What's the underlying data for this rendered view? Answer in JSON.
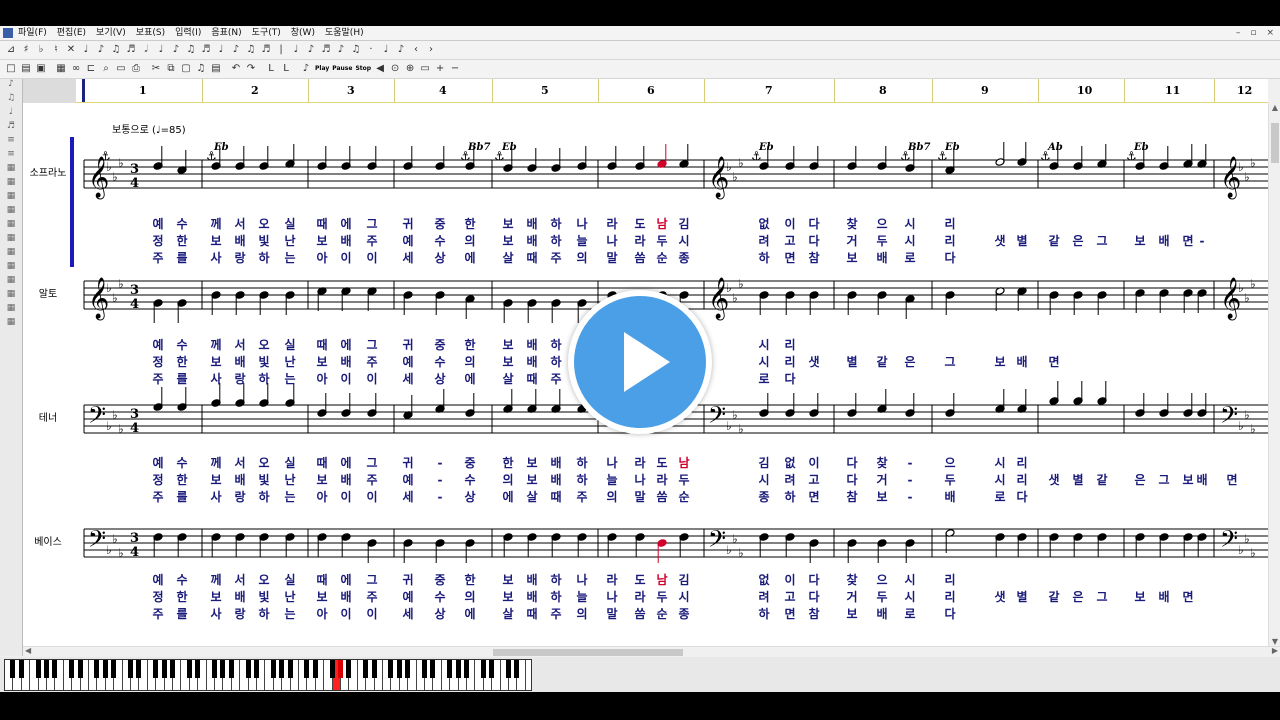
{
  "menu": [
    "파일(F)",
    "편집(E)",
    "보기(V)",
    "보표(S)",
    "입력(I)",
    "음표(N)",
    "도구(T)",
    "창(W)",
    "도움말(H)"
  ],
  "window_controls": [
    "–",
    "▫",
    "×"
  ],
  "toolbar_text_buttons": [
    "Play",
    "Pause",
    "Stop"
  ],
  "measure_numbers": [
    "1",
    "2",
    "3",
    "4",
    "5",
    "6",
    "7",
    "8",
    "9",
    "10",
    "11",
    "12"
  ],
  "tempo": "보통으로 (♩=85)",
  "time_signature": {
    "top": "3",
    "bottom": "4"
  },
  "staves": [
    {
      "name": "소프라노",
      "clef": "treble"
    },
    {
      "name": "알토",
      "clef": "treble"
    },
    {
      "name": "테너",
      "clef": "bass"
    },
    {
      "name": "베이스",
      "clef": "bass"
    }
  ],
  "chords": [
    "Eb",
    "Bb7",
    "Eb",
    "Eb",
    "Bb7",
    "Eb",
    "Ab",
    "Eb"
  ],
  "lyrics": {
    "soprano": [
      [
        "예",
        "수",
        "께",
        "서",
        "오",
        "실",
        "때",
        "에",
        "그",
        "귀",
        "중",
        "한",
        "보",
        "배",
        "하",
        "나",
        "라",
        "도",
        "남",
        "김",
        "없",
        "이",
        "다",
        "찾",
        "으",
        "시",
        "리"
      ],
      [
        "정",
        "한",
        "보",
        "배",
        "빛",
        "난",
        "보",
        "배",
        "주",
        "예",
        "수",
        "의",
        "보",
        "배",
        "하",
        "늘",
        "나",
        "라",
        "두",
        "시",
        "려",
        "고",
        "다",
        "거",
        "두",
        "시",
        "리",
        "샛",
        "별",
        "같",
        "은",
        "그",
        "보",
        "배",
        "면",
        "-"
      ],
      [
        "주",
        "를",
        "사",
        "랑",
        "하",
        "는",
        "아",
        "이",
        "이",
        "세",
        "상",
        "에",
        "살",
        "때",
        "주",
        "의",
        "말",
        "씀",
        "순",
        "종",
        "하",
        "면",
        "참",
        "보",
        "배",
        "로",
        "다"
      ]
    ],
    "alto": [
      [
        "예",
        "수",
        "께",
        "서",
        "오",
        "실",
        "때",
        "에",
        "그",
        "귀",
        "중",
        "한",
        "보",
        "배",
        "하",
        "없",
        "이",
        "다",
        "찾",
        "으",
        "시",
        "리"
      ],
      [
        "정",
        "한",
        "보",
        "배",
        "빛",
        "난",
        "보",
        "배",
        "주",
        "예",
        "수",
        "의",
        "보",
        "배",
        "하",
        "려",
        "고",
        "다",
        "거",
        "두",
        "시",
        "리",
        "샛",
        "별",
        "같",
        "은",
        "그",
        "보",
        "배",
        "면"
      ],
      [
        "주",
        "를",
        "사",
        "랑",
        "하",
        "는",
        "아",
        "이",
        "이",
        "세",
        "상",
        "에",
        "살",
        "때",
        "주",
        "하",
        "면",
        "참",
        "보",
        "배",
        "로",
        "다"
      ]
    ],
    "tenor": [
      [
        "예",
        "수",
        "께",
        "서",
        "오",
        "실",
        "때",
        "에",
        "그",
        "귀",
        "-",
        "중",
        "한",
        "보",
        "배",
        "하",
        "나",
        "라",
        "도",
        "남",
        "김",
        "없",
        "이",
        "다",
        "찾",
        "-",
        "으",
        "시",
        "리"
      ],
      [
        "정",
        "한",
        "보",
        "배",
        "빛",
        "난",
        "보",
        "배",
        "주",
        "예",
        "-",
        "수",
        "의",
        "보",
        "배",
        "하",
        "늘",
        "나",
        "라",
        "두",
        "시",
        "려",
        "고",
        "다",
        "거",
        "-",
        "두",
        "시",
        "리",
        "샛",
        "별",
        "같",
        "은",
        "그",
        "보",
        "배",
        "면"
      ],
      [
        "주",
        "를",
        "사",
        "랑",
        "하",
        "는",
        "아",
        "이",
        "이",
        "세",
        "-",
        "상",
        "에",
        "살",
        "때",
        "주",
        "의",
        "말",
        "씀",
        "순",
        "종",
        "하",
        "면",
        "참",
        "보",
        "-",
        "배",
        "로",
        "다"
      ]
    ],
    "bass": [
      [
        "예",
        "수",
        "께",
        "서",
        "오",
        "실",
        "때",
        "에",
        "그",
        "귀",
        "중",
        "한",
        "보",
        "배",
        "하",
        "나",
        "라",
        "도",
        "남",
        "김",
        "없",
        "이",
        "다",
        "찾",
        "으",
        "시",
        "리"
      ],
      [
        "정",
        "한",
        "보",
        "배",
        "빛",
        "난",
        "보",
        "배",
        "주",
        "예",
        "수",
        "의",
        "보",
        "배",
        "하",
        "늘",
        "나",
        "라",
        "두",
        "시",
        "려",
        "고",
        "다",
        "거",
        "두",
        "시",
        "리",
        "샛",
        "별",
        "같",
        "은",
        "그",
        "보",
        "배",
        "면"
      ],
      [
        "주",
        "를",
        "사",
        "랑",
        "하",
        "는",
        "아",
        "이",
        "이",
        "세",
        "상",
        "에",
        "살",
        "때",
        "주",
        "의",
        "말",
        "씀",
        "순",
        "종",
        "하",
        "면",
        "참",
        "보",
        "배",
        "로",
        "다"
      ]
    ]
  },
  "colors": {
    "accent_line": "#1a1ab8",
    "lyric": "#1a1a7a",
    "highlight": "#d0002a",
    "play": "#4a9fe6"
  },
  "icons": [
    "play-overlay-icon",
    "anchor-icon",
    "treble-clef-icon",
    "bass-clef-icon"
  ]
}
